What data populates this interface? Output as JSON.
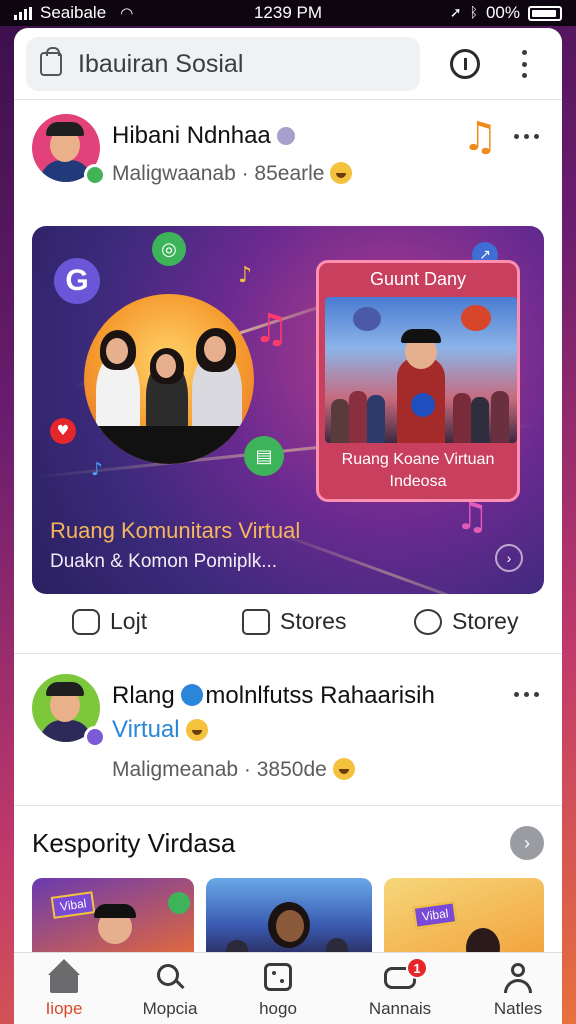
{
  "status_bar": {
    "carrier": "Seaibale",
    "time": "1239 PM",
    "battery": "00%"
  },
  "search": {
    "text": "Ibauiran Sosial",
    "icons": [
      "bag-icon",
      "info-icon",
      "kebab-icon"
    ]
  },
  "post1": {
    "author": "Hibani Ndnhaa",
    "meta_name": "Maligwaanab",
    "meta_time": "· 85earle",
    "icons": [
      "verified-icon",
      "music-note-icon",
      "more-icon"
    ]
  },
  "hero": {
    "inset_title": "Guunt Dany",
    "inset_caption_line1": "Ruang Koane Virtuan",
    "inset_caption_line2": "Indeosa",
    "title": "Ruang Komunitars Virtual",
    "subtitle": "Duakn & Komon Pomiplk...",
    "colors": {
      "accent": "#f6b75a",
      "inset_bg": "#c9405f"
    }
  },
  "actions": [
    {
      "label": "Lojt",
      "icon": "like-icon"
    },
    {
      "label": "Stores",
      "icon": "share-icon"
    },
    {
      "label": "Storey",
      "icon": "comment-icon"
    }
  ],
  "post2": {
    "author_part1": "Rlang",
    "author_part2": "molnlfutss Rahaarisih",
    "author_line2": "Virtual",
    "meta_name": "Maligmeanab",
    "meta_time": "· 3850de",
    "colors": {
      "virtual": "#2a86d8"
    }
  },
  "community": {
    "title": "Kespority Virdasa",
    "thumb_label": "Vibal"
  },
  "bottom_nav": [
    {
      "label": "Iiope",
      "icon": "home-icon",
      "active": true
    },
    {
      "label": "Mopcia",
      "icon": "search-icon",
      "active": false
    },
    {
      "label": "hogo",
      "icon": "dice-icon",
      "active": false
    },
    {
      "label": "Nannais",
      "icon": "chat-icon",
      "active": false,
      "badge": "1"
    },
    {
      "label": "Natles",
      "icon": "profile-icon",
      "active": false
    }
  ]
}
